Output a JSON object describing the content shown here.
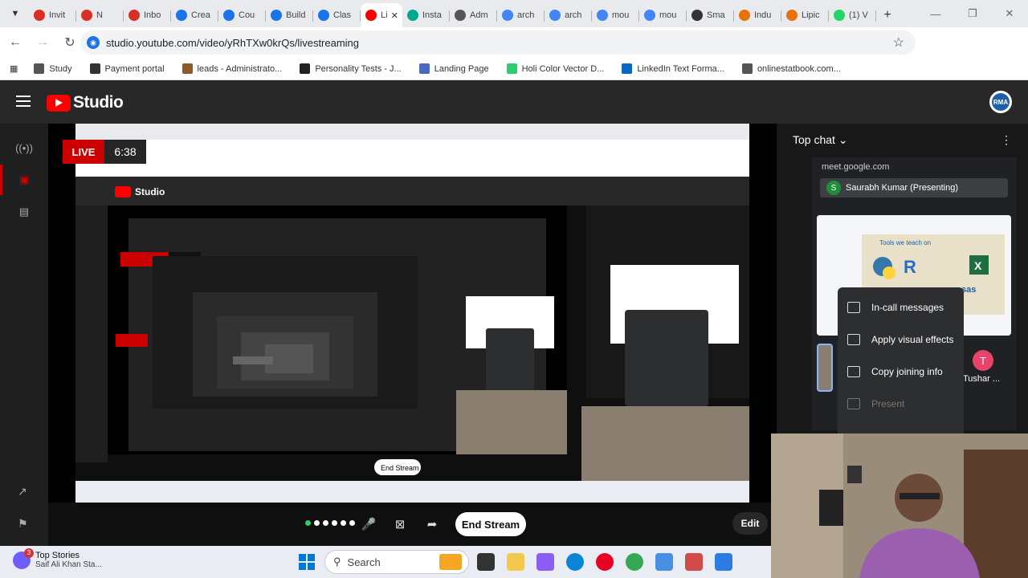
{
  "browser": {
    "tabs": [
      {
        "label": "Invit",
        "icon": "gmail-icon",
        "color": "#d93025"
      },
      {
        "label": "N",
        "icon": "gmail-icon",
        "color": "#d93025"
      },
      {
        "label": "Inbo",
        "icon": "gmail-icon",
        "color": "#d93025"
      },
      {
        "label": "Crea",
        "icon": "c-icon",
        "color": "#1a73e8"
      },
      {
        "label": "Cou",
        "icon": "c-icon",
        "color": "#1a73e8"
      },
      {
        "label": "Build",
        "icon": "c-icon",
        "color": "#1a73e8"
      },
      {
        "label": "Clas",
        "icon": "c-icon",
        "color": "#1a73e8"
      },
      {
        "label": "Li",
        "icon": "youtube-icon",
        "color": "#ff0000",
        "active": true
      },
      {
        "label": "Insta",
        "icon": "instatext-icon",
        "color": "#00a88e"
      },
      {
        "label": "Adm",
        "icon": "admin-icon",
        "color": "#555"
      },
      {
        "label": "arch",
        "icon": "google-icon",
        "color": "#4285f4"
      },
      {
        "label": "arch",
        "icon": "google-icon",
        "color": "#4285f4"
      },
      {
        "label": "mou",
        "icon": "google-icon",
        "color": "#4285f4"
      },
      {
        "label": "mou",
        "icon": "google-icon",
        "color": "#4285f4"
      },
      {
        "label": "Sma",
        "icon": "sma-icon",
        "color": "#333"
      },
      {
        "label": "Indu",
        "icon": "indu-icon",
        "color": "#e8710a"
      },
      {
        "label": "Lipic",
        "icon": "e-icon",
        "color": "#e8710a"
      },
      {
        "label": "(1) V",
        "icon": "wa-icon",
        "color": "#25d366"
      }
    ],
    "url": "studio.youtube.com/video/yRhTXw0krQs/livestreaming",
    "bookmarks": [
      {
        "label": "Study",
        "icon": "folder-icon"
      },
      {
        "label": "Payment portal",
        "icon": "portal-icon"
      },
      {
        "label": "leads - Administrato...",
        "icon": "leads-icon"
      },
      {
        "label": "Personality Tests - J...",
        "icon": "jc-icon"
      },
      {
        "label": "Landing Page",
        "icon": "landing-icon"
      },
      {
        "label": "Holi Color Vector D...",
        "icon": "holi-icon"
      },
      {
        "label": "LinkedIn Text Forma...",
        "icon": "linkedin-icon"
      },
      {
        "label": "onlinestatbook.com...",
        "icon": "globe-icon"
      }
    ]
  },
  "studio": {
    "logo_text": "Studio",
    "avatar_text": "RMA",
    "live_label": "LIVE",
    "live_time": "6:38",
    "end_stream": "End Stream",
    "edit": "Edit",
    "top_chat": "Top chat",
    "meet_url": "meet.google.com",
    "presenter": "Saurabh Kumar (Presenting)",
    "presenter_initial": "S",
    "menu_items": [
      {
        "label": "In-call messages",
        "disabled": false
      },
      {
        "label": "Apply visual effects",
        "disabled": false
      },
      {
        "label": "Copy joining info",
        "disabled": false
      },
      {
        "label": "Present",
        "disabled": true
      }
    ],
    "participant_initial": "T",
    "participant_name": "Tushar ...",
    "slide_text": "Tools we teach on"
  },
  "taskbar": {
    "stories_title": "Top Stories",
    "stories_sub": "Saif Ali Khan Sta...",
    "stories_badge": "3",
    "search_placeholder": "Search"
  }
}
